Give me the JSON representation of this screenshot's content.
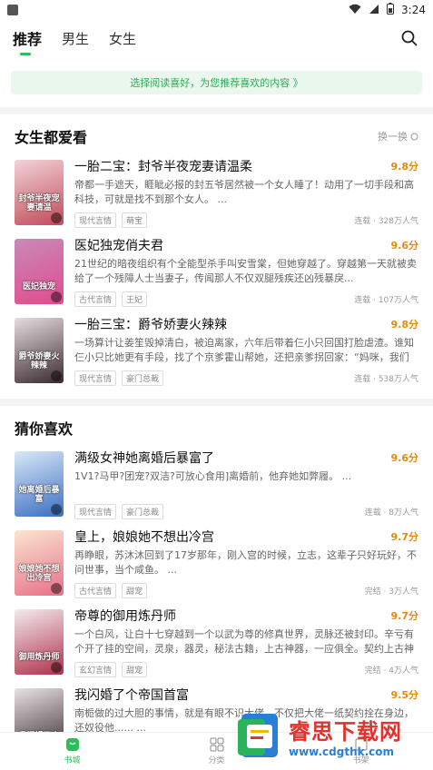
{
  "status": {
    "time": "3:24"
  },
  "nav": {
    "tabs": [
      "推荐",
      "男生",
      "女生"
    ]
  },
  "banner": {
    "text": "选择阅读喜好，为您推荐喜欢的内容 》"
  },
  "sections": [
    {
      "title": "女生都爱看",
      "action": "换一换",
      "books": [
        {
          "title": "一胎二宝：封爷半夜宠妻请温柔",
          "score": "9.8分",
          "desc": "帝都一手遮天，睚眦必报的封五爷居然被一个女人睡了！动用了一切手段和高科技，可就是找不到那个女人。 ...",
          "tags": [
            "现代言情",
            "萌宝"
          ],
          "meta": "连载 · 328万人气",
          "cover_text": "封爷半夜宠妻请温",
          "cover_colors": [
            "#f2d4d8",
            "#c24a5a"
          ]
        },
        {
          "title": "医妃独宠俏夫君",
          "score": "9.6分",
          "desc": "21世纪的暗夜组织有个全能型杀手叫安雪棠，但她穿越了。穿越第一天就被卖给了一个残障人士当妻子，传闻那人不仅双腿残疾还凶残暴戾...",
          "tags": [
            "古代言情",
            "王妃"
          ],
          "meta": "连载 · 107万人气",
          "cover_text": "医妃独宠",
          "cover_colors": [
            "#c88ab8",
            "#e24a8c"
          ]
        },
        {
          "title": "一胎三宝：爵爷娇妻火辣辣",
          "score": "9.8分",
          "desc": "一场算计让姜笙毁掉清白，被迫离家，六年后带着仨小只回国打脸虐渣。谁知仨小只比她更有手段，找了个京爹霍山帮她，还把亲爹拐回家：“妈咪，我们把爹...",
          "tags": [
            "现代言情",
            "豪门总裁"
          ],
          "meta": "连载 · 538万人气",
          "cover_text": "爵爷娇妻火辣辣",
          "cover_colors": [
            "#e7dde0",
            "#3a2a30"
          ]
        }
      ]
    },
    {
      "title": "猜你喜欢",
      "books": [
        {
          "title": "满级女神她离婚后暴富了",
          "score": "9.6分",
          "desc": "1V1?马甲?团宠?双洁?可放心食用]离婚前，他弃她如弊履。 ...",
          "tags": [
            "现代言情",
            "豪门总裁"
          ],
          "meta": "连载 · 8万人气",
          "cover_text": "她离婚后暴富",
          "cover_colors": [
            "#d9e8f7",
            "#3b6fc2"
          ]
        },
        {
          "title": "皇上，娘娘她不想出冷宫",
          "score": "9.7分",
          "desc": "再睁眼，苏沐沐回到了17岁那年，刚入宫的时候，立志，这辈子只好玩好，不问世事，当个咸鱼。 ...",
          "tags": [
            "古代言情",
            "甜宠"
          ],
          "meta": "完结 · 3万人气",
          "cover_text": "娘娘她不想出冷宫",
          "cover_colors": [
            "#fbe6cf",
            "#e86f8a"
          ]
        },
        {
          "title": "帝尊的御用炼丹师",
          "score": "9.7分",
          "desc": "一个白风，让白十七穿越到一个以武为尊的修真世界，灵脉还被封印。辛亏有个开了挂的空间，灵泉，器灵，秘法古籍，上古神器，一应俱全。契约上古神兽也...",
          "tags": [
            "玄幻言情",
            "甜宠"
          ],
          "meta": "完结 · 4万人气",
          "cover_text": "御用炼丹师",
          "cover_colors": [
            "#f3ecef",
            "#b0304a"
          ]
        },
        {
          "title": "我闪婚了个帝国首富",
          "score": "9.5分",
          "desc": "南栀做的过大胆的事情，就是有眼不识大佬，不仅把大佬一纸契约拴在身边，还奴役他...... ...",
          "tags": [],
          "meta": "",
          "cover_text": "我闪婚了个",
          "cover_colors": [
            "#e9e2e4",
            "#3a2c33"
          ]
        }
      ]
    }
  ],
  "bottom": {
    "items": [
      "书城",
      "分类",
      "书架"
    ]
  },
  "watermark": {
    "big": "睿思下载网",
    "small": "www.cdgthk.com"
  }
}
